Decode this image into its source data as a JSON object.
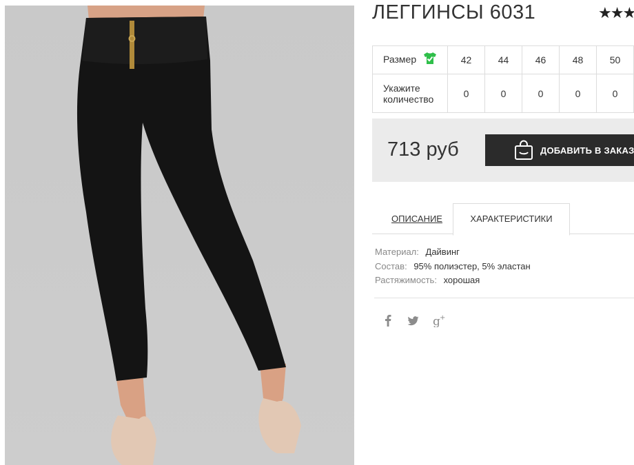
{
  "product": {
    "title": "ЛЕГГИНСЫ 6031",
    "rating_stars": "★★★"
  },
  "size_table": {
    "size_label": "Размер",
    "qty_label": "Укажите количество",
    "sizes": [
      "42",
      "44",
      "46",
      "48",
      "50"
    ],
    "quantities": [
      "0",
      "0",
      "0",
      "0",
      "0"
    ]
  },
  "purchase": {
    "price": "713 руб",
    "add_button_label": "ДОБАВИТЬ В ЗАКАЗ"
  },
  "tabs": {
    "description": "ОПИСАНИЕ",
    "characteristics": "ХАРАКТЕРИСТИКИ"
  },
  "specs": [
    {
      "key": "Материал:",
      "value": "Дайвинг"
    },
    {
      "key": "Состав:",
      "value": "95% полиэстер, 5% эластан"
    },
    {
      "key": "Растяжимость:",
      "value": "хорошая"
    }
  ],
  "social": [
    "facebook-icon",
    "twitter-icon",
    "google-plus-icon"
  ],
  "colors": {
    "button_bg": "#2b2b2b",
    "price_box_bg": "#ebebeb",
    "size_icon_green": "#2fbf4a"
  }
}
